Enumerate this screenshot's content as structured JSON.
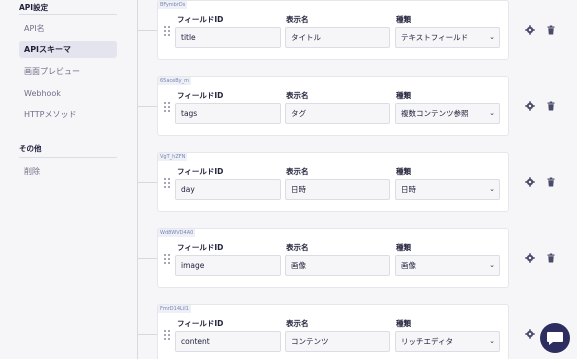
{
  "sidebar": {
    "api_settings_title": "API設定",
    "items": [
      {
        "label": "API名"
      },
      {
        "label": "APIスキーマ"
      },
      {
        "label": "画面プレビュー"
      },
      {
        "label": "Webhook"
      },
      {
        "label": "HTTPメソッド"
      }
    ],
    "other_title": "その他",
    "other_items": [
      {
        "label": "削除"
      }
    ]
  },
  "schema": {
    "field_id_label": "フィールドID",
    "display_name_label": "表示名",
    "type_label": "種類",
    "fields": [
      {
        "internal_id": "BFymbrDs",
        "field_id": "title",
        "display_name": "タイトル",
        "type": "テキストフィールド"
      },
      {
        "internal_id": "65aceBy_m",
        "field_id": "tags",
        "display_name": "タグ",
        "type": "複数コンテンツ参照"
      },
      {
        "internal_id": "VgT_hZFN",
        "field_id": "day",
        "display_name": "日時",
        "type": "日時"
      },
      {
        "internal_id": "Wd8WVD4A0",
        "field_id": "image",
        "display_name": "画像",
        "type": "画像"
      },
      {
        "internal_id": "FmrD14LiI1",
        "field_id": "content",
        "display_name": "コンテンツ",
        "type": "リッチエディタ"
      }
    ]
  },
  "icons": {
    "drag": "drag-handle-icon",
    "settings": "gear-icon",
    "delete": "trash-icon",
    "select": "chevron-down-icon",
    "chat": "chat-icon"
  },
  "colors": {
    "background": "#f6f6f9",
    "sidebar_active": "#e4e4ee",
    "text": "#21213b",
    "muted": "#6e6e87",
    "chat_button": "#2d2e5f"
  }
}
